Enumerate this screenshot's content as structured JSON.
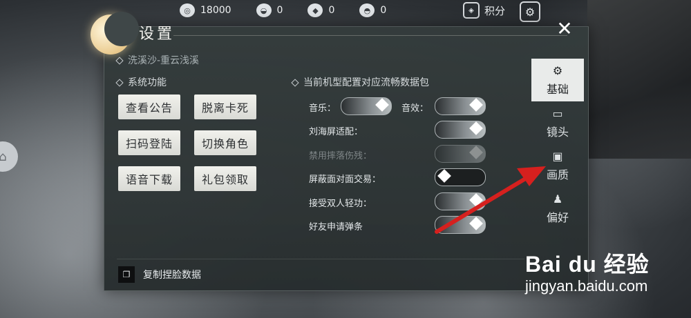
{
  "currency": [
    {
      "icon": "film-reel-icon",
      "value": "18000"
    },
    {
      "icon": "ingot-icon",
      "value": "0"
    },
    {
      "icon": "ticket-icon",
      "value": "0"
    },
    {
      "icon": "coin-pile-icon",
      "value": "0"
    }
  ],
  "points_label": "积分",
  "panel": {
    "title": "设置",
    "close": "✕",
    "breadcrumb": "洗溪沙-重云浅溪",
    "system_section": "系统功能",
    "buttons": [
      "查看公告",
      "脱离卡死",
      "扫码登陆",
      "切换角色",
      "语音下载",
      "礼包领取"
    ],
    "perf_section": "当前机型配置对应流畅数据包",
    "settings": {
      "music": "音乐：",
      "sfx": "音效：",
      "notch": "刘海屏适配：",
      "fall_damage": "禁用摔落伤残：",
      "block_trade": "屏蔽面对面交易：",
      "dual_qinggong": "接受双人轻功：",
      "friend_popup": "好友申请弹条"
    },
    "copy_face": "复制捏脸数据"
  },
  "tabs": [
    "基础",
    "镜头",
    "画质",
    "偏好"
  ],
  "watermark": {
    "main": "Bai du 经验",
    "sub": "jingyan.baidu.com"
  },
  "colors": {
    "annotation_arrow": "#d6201e",
    "active_tab_bg": "#e9ebea"
  }
}
